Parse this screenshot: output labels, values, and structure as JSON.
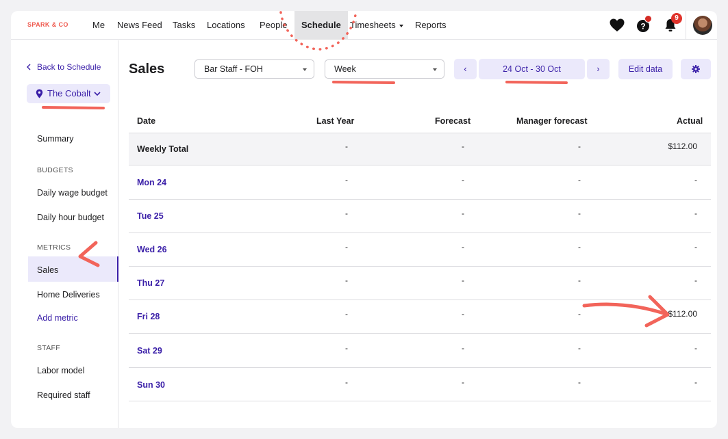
{
  "brand": "SPARK & CO",
  "nav": {
    "items": [
      "Me",
      "News Feed",
      "Tasks",
      "Locations",
      "People",
      "Schedule",
      "Timesheets",
      "Reports"
    ],
    "active": "Schedule",
    "notification_count": "9"
  },
  "sidebar": {
    "back_label": "Back to Schedule",
    "location": "The Cobalt",
    "summary": "Summary",
    "budgets_heading": "BUDGETS",
    "budgets": [
      "Daily wage budget",
      "Daily hour budget"
    ],
    "metrics_heading": "METRICS",
    "metrics": [
      "Sales",
      "Home Deliveries"
    ],
    "add_metric": "Add metric",
    "staff_heading": "STAFF",
    "staff": [
      "Labor model",
      "Required staff"
    ]
  },
  "header": {
    "title": "Sales",
    "team_select": "Bar Staff - FOH",
    "period_select": "Week",
    "date_range": "24 Oct - 30 Oct",
    "prev": "‹",
    "next": "›",
    "edit_button": "Edit data"
  },
  "table": {
    "columns": [
      "Date",
      "Last Year",
      "Forecast",
      "Manager forecast",
      "Actual"
    ],
    "rows": [
      {
        "date": "Weekly Total",
        "last_year": "-",
        "forecast": "-",
        "manager": "-",
        "actual": "$112.00"
      },
      {
        "date": "Mon 24",
        "last_year": "-",
        "forecast": "-",
        "manager": "-",
        "actual": "-"
      },
      {
        "date": "Tue 25",
        "last_year": "-",
        "forecast": "-",
        "manager": "-",
        "actual": "-"
      },
      {
        "date": "Wed 26",
        "last_year": "-",
        "forecast": "-",
        "manager": "-",
        "actual": "-"
      },
      {
        "date": "Thu 27",
        "last_year": "-",
        "forecast": "-",
        "manager": "-",
        "actual": "-"
      },
      {
        "date": "Fri 28",
        "last_year": "-",
        "forecast": "-",
        "manager": "-",
        "actual": "$112.00"
      },
      {
        "date": "Sat 29",
        "last_year": "-",
        "forecast": "-",
        "manager": "-",
        "actual": "-"
      },
      {
        "date": "Sun 30",
        "last_year": "-",
        "forecast": "-",
        "manager": "-",
        "actual": "-"
      }
    ]
  },
  "colors": {
    "accent": "#3a1fa8",
    "accent_bg": "#ebe9fb",
    "brand": "#ef5a4f",
    "annotation": "#f2645a"
  }
}
